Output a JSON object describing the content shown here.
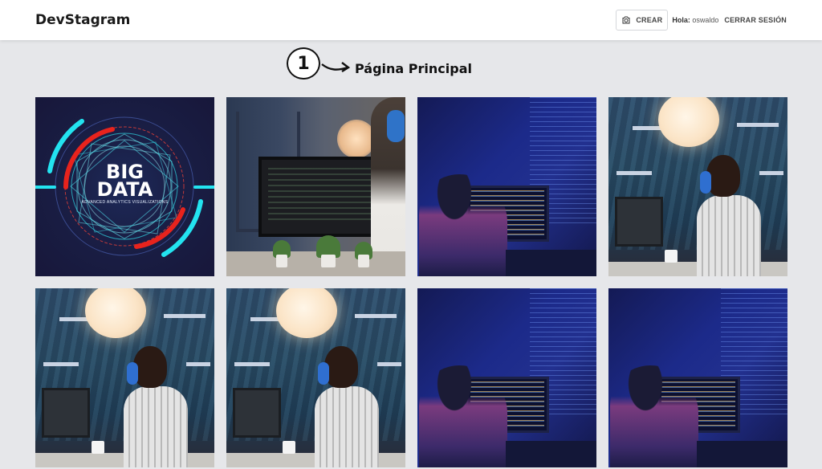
{
  "header": {
    "brand": "DevStagram",
    "crear_label": "CREAR",
    "greeting_prefix": "Hola:",
    "username": "oswaldo",
    "logout_label": "CERRAR SESIÓN"
  },
  "annotation": {
    "marker_number": "1"
  },
  "page": {
    "title": "Página Principal"
  },
  "posts": [
    {
      "kind": "big-data-graphic",
      "title": "BIG DATA",
      "subtitle": "ADVANCED ANALYTICS VISUALIZATIONS"
    },
    {
      "kind": "laptop-desk-photo"
    },
    {
      "kind": "blue-coder-photo"
    },
    {
      "kind": "headphones-man-photo"
    },
    {
      "kind": "headphones-man-photo"
    },
    {
      "kind": "headphones-man-photo"
    },
    {
      "kind": "blue-coder-photo"
    },
    {
      "kind": "blue-coder-photo"
    }
  ],
  "colors": {
    "page_background": "#e6e7ea",
    "header_background": "#ffffff",
    "bigdata_cyan": "#23e3f0",
    "bigdata_red": "#e8231d"
  }
}
